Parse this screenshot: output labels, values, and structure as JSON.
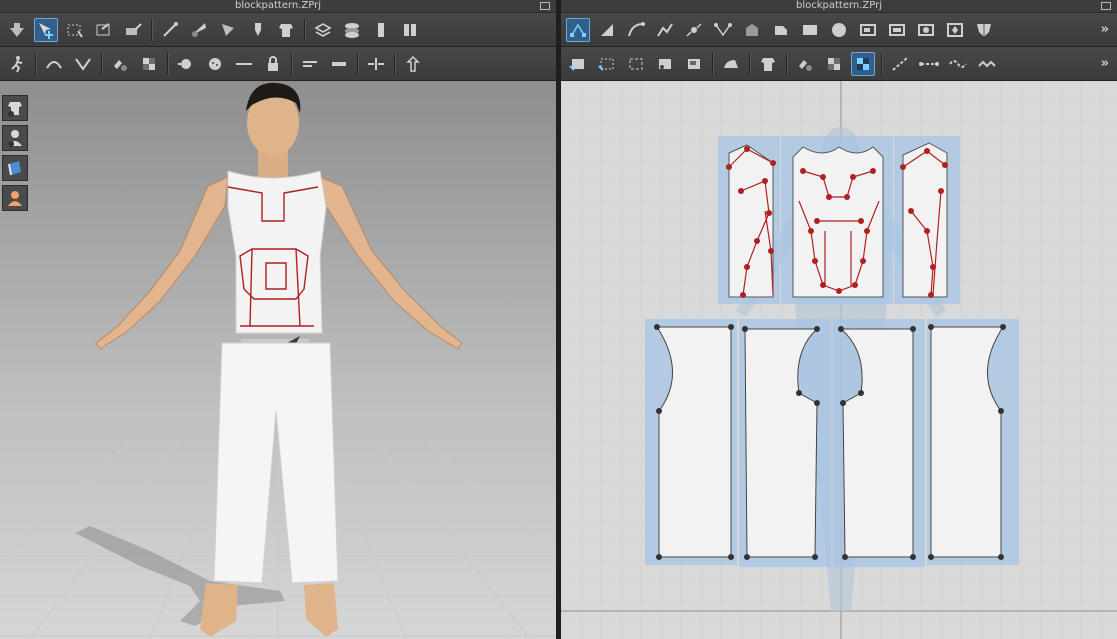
{
  "left_window": {
    "title": "blockpattern.ZPrj"
  },
  "right_window": {
    "title": "blockpattern.ZPrj"
  },
  "toolbars": {
    "left_row1": [
      "down-arrow-icon",
      "select-transform-icon",
      "box-select-icon",
      "edit-mesh-icon",
      "camera-pencil-icon",
      "line-tool-icon",
      "blade-icon",
      "cone-tool-icon",
      "pin-icon",
      "garment-icon",
      "layer-stack-icon",
      "layer-alt-icon",
      "bolt-icon",
      "split-icon"
    ],
    "left_row2": [
      "walk-icon",
      "curve-icon",
      "fold-icon",
      "cloth-brush-icon",
      "checker-icon",
      "button-point-icon",
      "button-icon",
      "line-measure-icon",
      "lock-icon",
      "mark-icon",
      "bar-icon",
      "strap-icon",
      "arrows-icon"
    ],
    "right_row1": [
      "select-points-icon",
      "triangle-icon",
      "curve-edit-icon",
      "polyline-icon",
      "point-icon",
      "segment-icon",
      "edit-points-icon",
      "rect-icon",
      "square-icon",
      "circle-icon",
      "rounded-rect-icon",
      "rect-frame-icon",
      "shield-icon",
      "diamond-icon",
      "pattern-icon"
    ],
    "right_row2": [
      "move-pattern-icon",
      "offset-icon",
      "sew-icon",
      "sew-alt-icon",
      "sew-tag-icon",
      "iron-icon",
      "shirt-icon",
      "paint-icon",
      "texture-icon",
      "texture-active-icon",
      "diagonal-icon",
      "dashed-icon",
      "wave-icon",
      "zigzag-icon"
    ]
  },
  "side_tools": [
    "garment-view-icon",
    "avatar-view-icon",
    "fabric-view-icon",
    "skin-view-icon"
  ],
  "colors": {
    "accent": "#6fa6d6",
    "seam_red": "#b02020",
    "pattern_fill": "#f2f2f2",
    "pattern_highlight": "#a6c4e6"
  }
}
